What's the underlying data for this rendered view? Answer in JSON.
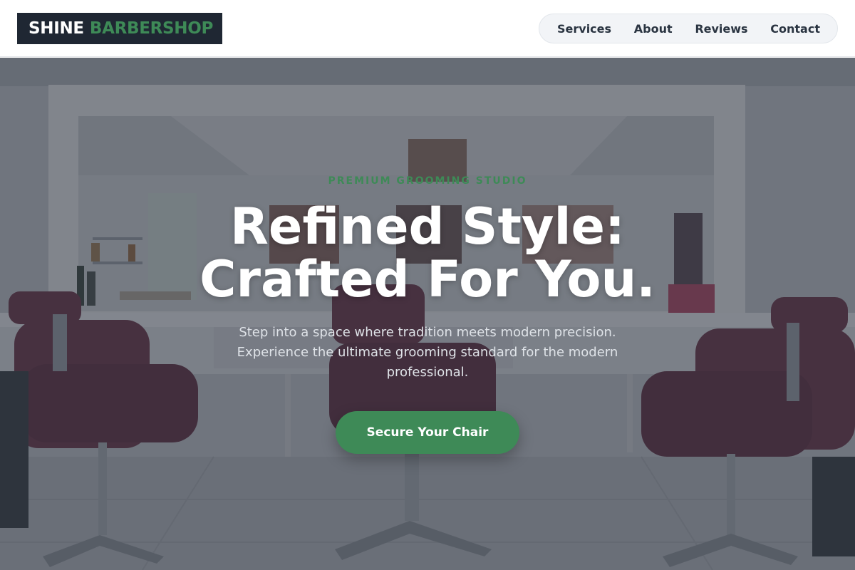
{
  "brand": {
    "name_part1": "SHINE",
    "name_part2": "BARBERSHOP"
  },
  "nav": {
    "items": [
      "Services",
      "About",
      "Reviews",
      "Contact"
    ]
  },
  "hero": {
    "eyebrow": "PREMIUM GROOMING STUDIO",
    "headline_line1": "Refined Style:",
    "headline_line2": "Crafted For You.",
    "subtext": "Step into a space where tradition meets modern precision. Experience the ultimate grooming standard for the modern professional.",
    "cta_label": "Secure Your Chair",
    "background_image": "salon-interior-with-styling-chairs"
  },
  "colors": {
    "brand_dark": "#1f2733",
    "accent_green": "#3e8a57",
    "nav_bg": "#f2f4f7",
    "text_dark": "#2a3441",
    "chair_maroon": "#6e3a4d"
  }
}
